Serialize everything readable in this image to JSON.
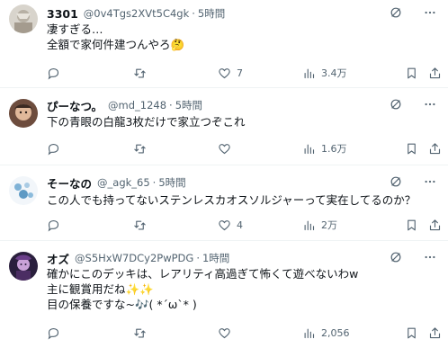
{
  "replies": [
    {
      "name": "3301",
      "handle": "@0v4Tgs2XVt5C4gk",
      "time": "5時間",
      "lines": [
        "凄すぎる…",
        "全額で家何件建つんやろ🤔"
      ],
      "views": "3.4万",
      "likes": "7",
      "retweets": "",
      "replies": ""
    },
    {
      "name": "ぴーなつ。",
      "handle": "@md_1248",
      "time": "5時間",
      "lines": [
        "下の青眼の白龍3枚だけで家立つぞこれ"
      ],
      "views": "1.6万",
      "likes": "",
      "retweets": "",
      "replies": ""
    },
    {
      "name": "そーなの",
      "handle": "@_agk_65",
      "time": "5時間",
      "lines": [
        "この人でも持ってないステンレスカオスソルジャーって実在してるのか？"
      ],
      "views": "2万",
      "likes": "4",
      "retweets": "",
      "replies": ""
    },
    {
      "name": "オズ",
      "handle": "@S5HxW7DCy2PwPDG",
      "time": "1時間",
      "lines": [
        "確かにこのデッキは、レアリティ高過ぎて怖くて遊べないわw",
        "主に観賞用だね✨✨",
        "目の保養ですな~🎶( *´ω`* )"
      ],
      "views": "2,056",
      "likes": "",
      "retweets": "",
      "replies": ""
    }
  ],
  "dot": "·",
  "colors": {
    "text": "#0f1419",
    "muted": "#536471",
    "divider": "#eff3f4"
  }
}
